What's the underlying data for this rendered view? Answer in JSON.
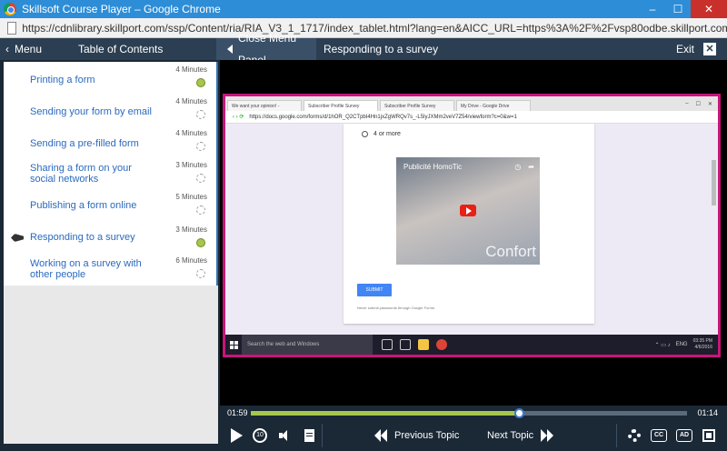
{
  "window": {
    "title": "Skillsoft Course Player – Google Chrome",
    "url": "https://cdnlibrary.skillport.com/ssp/Content/ria/RIA_V3_1_1717/index_tablet.html?lang=en&AICC_URL=https%3A%2F%2Fvsp80odbe.skillport.com%3A443%2Fskillportbe%2Fs...",
    "minimize": "–",
    "maximize": "☐",
    "close": "✕"
  },
  "header": {
    "menu_label": "Menu",
    "toc_title": "Table of Contents",
    "close_panel_label": "Close Menu Panel",
    "current_topic": "Responding to a survey",
    "exit_label": "Exit",
    "exit_x": "✕"
  },
  "toc": {
    "items": [
      {
        "label": "Printing a form",
        "duration": "4 Minutes",
        "status": "done"
      },
      {
        "label": "Sending your form by email",
        "duration": "4 Minutes",
        "status": "todo"
      },
      {
        "label": "Sending a pre-filled form",
        "duration": "4 Minutes",
        "status": "todo"
      },
      {
        "label": "Sharing a form on your social networks",
        "duration": "3 Minutes",
        "status": "todo"
      },
      {
        "label": "Publishing a form online",
        "duration": "5 Minutes",
        "status": "todo"
      },
      {
        "label": "Responding to a survey",
        "duration": "3 Minutes",
        "status": "done",
        "current": true
      },
      {
        "label": "Working on a survey with other people",
        "duration": "6 Minutes",
        "status": "todo"
      }
    ]
  },
  "video": {
    "tabs": [
      "We want your opinion! -",
      "Subscriber Profile Survey",
      "Subscriber Profile Survey",
      "My Drive - Google Drive"
    ],
    "inner_url": "https://docs.google.com/forms/d/1hOR_Q2CTpbI4Hn1jxZgWRQv7s_-L5lyJXMm2veV7Z54/viewform?c=0&w=1",
    "radio_option": "4 or more",
    "yt_title": "Publicité HomoTic",
    "yt_watermark": "Confort",
    "submit_label": "SUBMIT",
    "never_text": "Never submit passwords through Google Forms.",
    "disclaimer": "This content is neither created nor endorsed by Google. Report Abuse - Terms of Service - Additional Terms",
    "taskbar_search": "Search the web and Windows",
    "tray_lang": "ENG",
    "tray_time": "03:35 PM",
    "tray_date": "4/6/2016"
  },
  "player": {
    "elapsed": "01:59",
    "remaining": "01:14",
    "progress": 0.617,
    "replay_label": "10",
    "prev_label": "Previous Topic",
    "next_label": "Next Topic",
    "cc_label": "CC",
    "ad_label": "AD"
  },
  "colors": {
    "accent": "#2f70b5",
    "done": "#a6c64c",
    "highlight_border": "#c8157a"
  }
}
